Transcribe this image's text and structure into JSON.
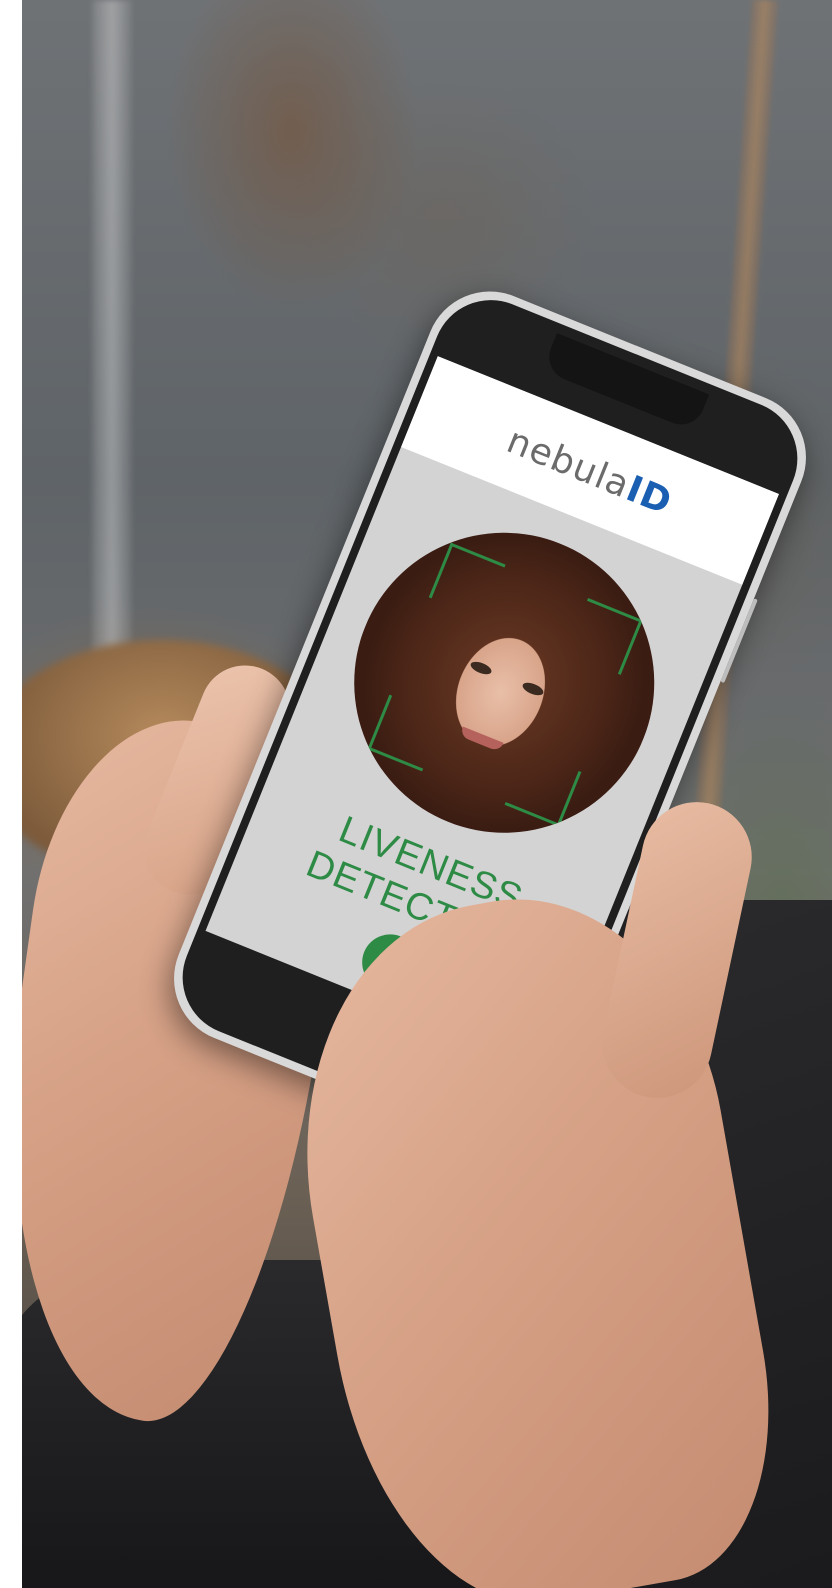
{
  "screen": {
    "brand_name": "nebula",
    "brand_suffix": "ID",
    "status_line1": "LIVENESS",
    "status_line2": "DETECTION",
    "status_icon": "check-icon"
  },
  "colors": {
    "brand_blue": "#1b5fb3",
    "brand_gray": "#6b6b6b",
    "success_green": "#2e8b45",
    "screen_bg": "#d3d3d3",
    "phone_frame": "#1f1f1f"
  }
}
